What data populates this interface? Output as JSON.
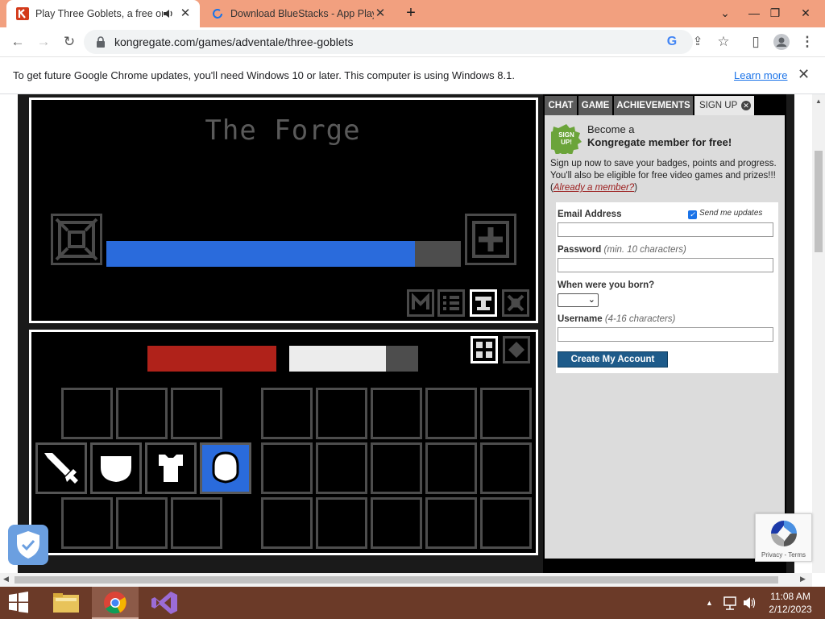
{
  "browser": {
    "tabs": [
      {
        "title": "Play Three Goblets, a free on",
        "active": true
      },
      {
        "title": "Download BlueStacks - App Playe",
        "active": false
      }
    ],
    "new_tab": "+",
    "url": "kongregate.com/games/adventale/three-goblets"
  },
  "infobar": {
    "message": "To get future Google Chrome updates, you'll need Windows 10 or later. This computer is using Windows 8.1.",
    "link": "Learn more"
  },
  "game": {
    "title": "The Forge",
    "forge_progress": 0.87,
    "health_fill": 1.0,
    "stamina_fill": 0.75,
    "colors": {
      "progress": "#2a6bdc",
      "health": "#b0221a",
      "stamina": "#ececec",
      "selected": "#2a6bdc"
    }
  },
  "kongregate": {
    "tabs": [
      "CHAT",
      "GAME",
      "ACHIEVEMENTS",
      "SIGN UP"
    ],
    "badge": [
      "SIGN",
      "UP!"
    ],
    "become": "Become a",
    "member": "Kongregate member for free!",
    "pitch": "Sign up now to save your badges, points and progress. You'll also be eligible for free video games and prizes!!! (",
    "already": "Already a member?",
    "pitch_end": ")",
    "email_label": "Email Address",
    "send_updates": "Send me updates",
    "send_updates_checked": true,
    "password_label": "Password",
    "password_hint": "(min. 10 characters)",
    "born_label": "When were you born?",
    "username_label": "Username",
    "username_hint": "(4-16 characters)",
    "create_button": "Create My Account"
  },
  "recaptcha": {
    "links": "Privacy - Terms"
  },
  "taskbar": {
    "time": "11:08 AM",
    "date": "2/12/2023"
  }
}
